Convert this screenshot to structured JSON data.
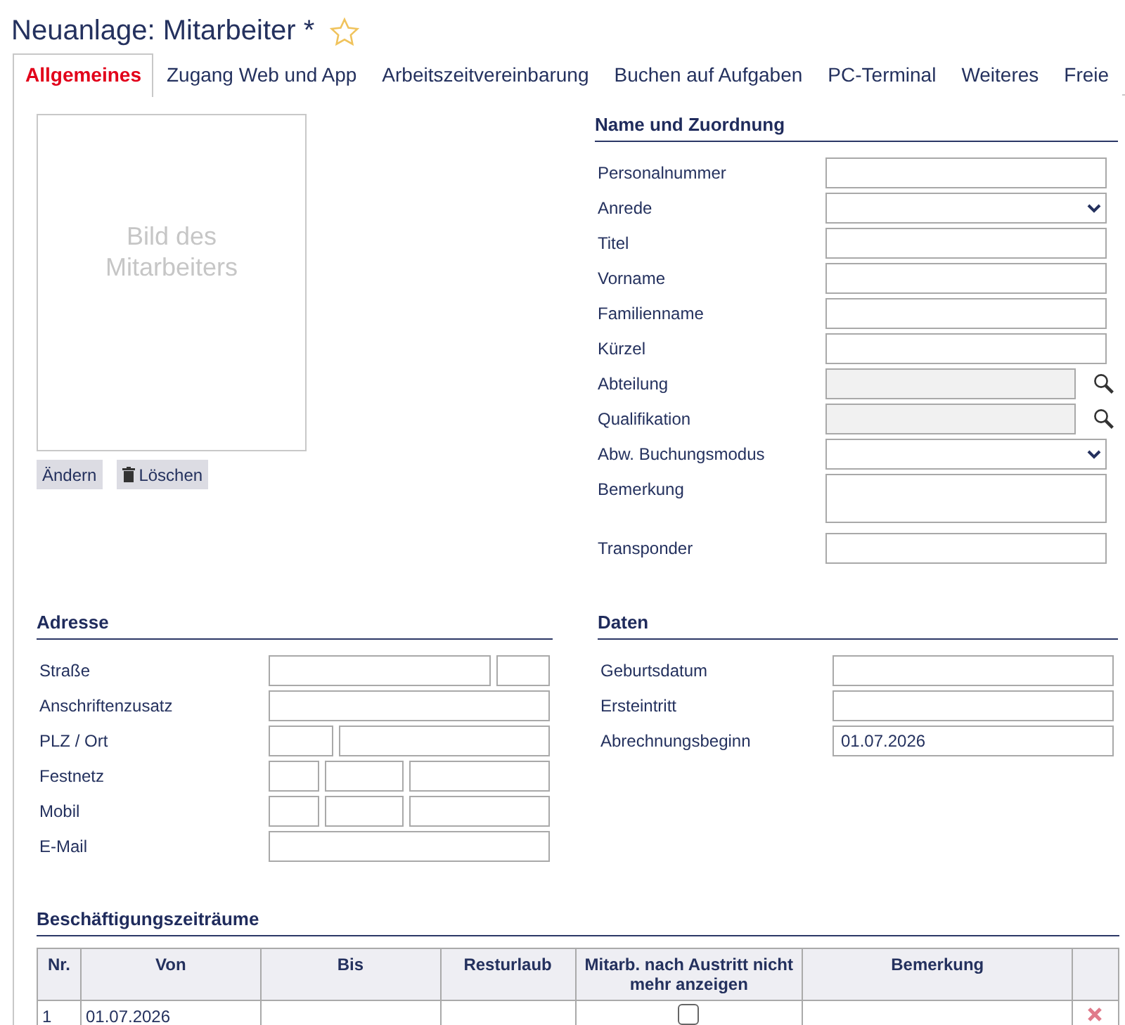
{
  "title": "Neuanlage: Mitarbeiter *",
  "favorite": false,
  "tabs": [
    {
      "label": "Allgemeines",
      "selected": true
    },
    {
      "label": "Zugang Web und App",
      "selected": false
    },
    {
      "label": "Arbeitszeitvereinbarung",
      "selected": false
    },
    {
      "label": "Buchen auf Aufgaben",
      "selected": false
    },
    {
      "label": "PC-Terminal",
      "selected": false
    },
    {
      "label": "Weiteres",
      "selected": false
    },
    {
      "label": "Freie",
      "selected": false
    }
  ],
  "photo": {
    "placeholder": "Bild des Mitarbeiters",
    "buttons": [
      {
        "label": "Ändern",
        "kind": "plain"
      },
      {
        "label": "Löschen",
        "kind": "delete"
      }
    ]
  },
  "name_section": {
    "title": "Name und Zuordnung",
    "fields": [
      {
        "label": "Personalnummer",
        "kind": "text"
      },
      {
        "label": "Anrede",
        "kind": "select"
      },
      {
        "label": "Titel",
        "kind": "text"
      },
      {
        "label": "Vorname",
        "kind": "text"
      },
      {
        "label": "Familienname",
        "kind": "text"
      },
      {
        "label": "Kürzel",
        "kind": "text"
      },
      {
        "label": "Abteilung",
        "kind": "lookup"
      },
      {
        "label": "Qualifikation",
        "kind": "lookup"
      },
      {
        "label": "Abw. Buchungsmodus",
        "kind": "select"
      },
      {
        "label": "Bemerkung",
        "kind": "textarea"
      },
      {
        "label": "Transponder",
        "kind": "text"
      }
    ]
  },
  "address_section": {
    "title": "Adresse",
    "fields": [
      {
        "label": "Straße",
        "kind": "street"
      },
      {
        "label": "Anschriftenzusatz",
        "kind": "text"
      },
      {
        "label": "PLZ / Ort",
        "kind": "plz"
      },
      {
        "label": "Festnetz",
        "kind": "phone"
      },
      {
        "label": "Mobil",
        "kind": "phone"
      },
      {
        "label": "E-Mail",
        "kind": "text"
      }
    ]
  },
  "data_section": {
    "title": "Daten",
    "fields": [
      {
        "label": "Geburtsdatum",
        "kind": "text"
      },
      {
        "label": "Ersteintritt",
        "kind": "text"
      },
      {
        "label": "Abrechnungsbeginn",
        "kind": "text",
        "value": "01.07.2026"
      }
    ]
  },
  "employment": {
    "title": "Beschäftigungszeiträume",
    "columns": [
      "Nr.",
      "Von",
      "Bis",
      "Resturlaub",
      "Mitarb. nach Austritt nicht mehr anzeigen",
      "Bemerkung"
    ],
    "rows": [
      {
        "nr": "1",
        "von": "01.07.2026",
        "hide_after_exit": false
      }
    ]
  }
}
